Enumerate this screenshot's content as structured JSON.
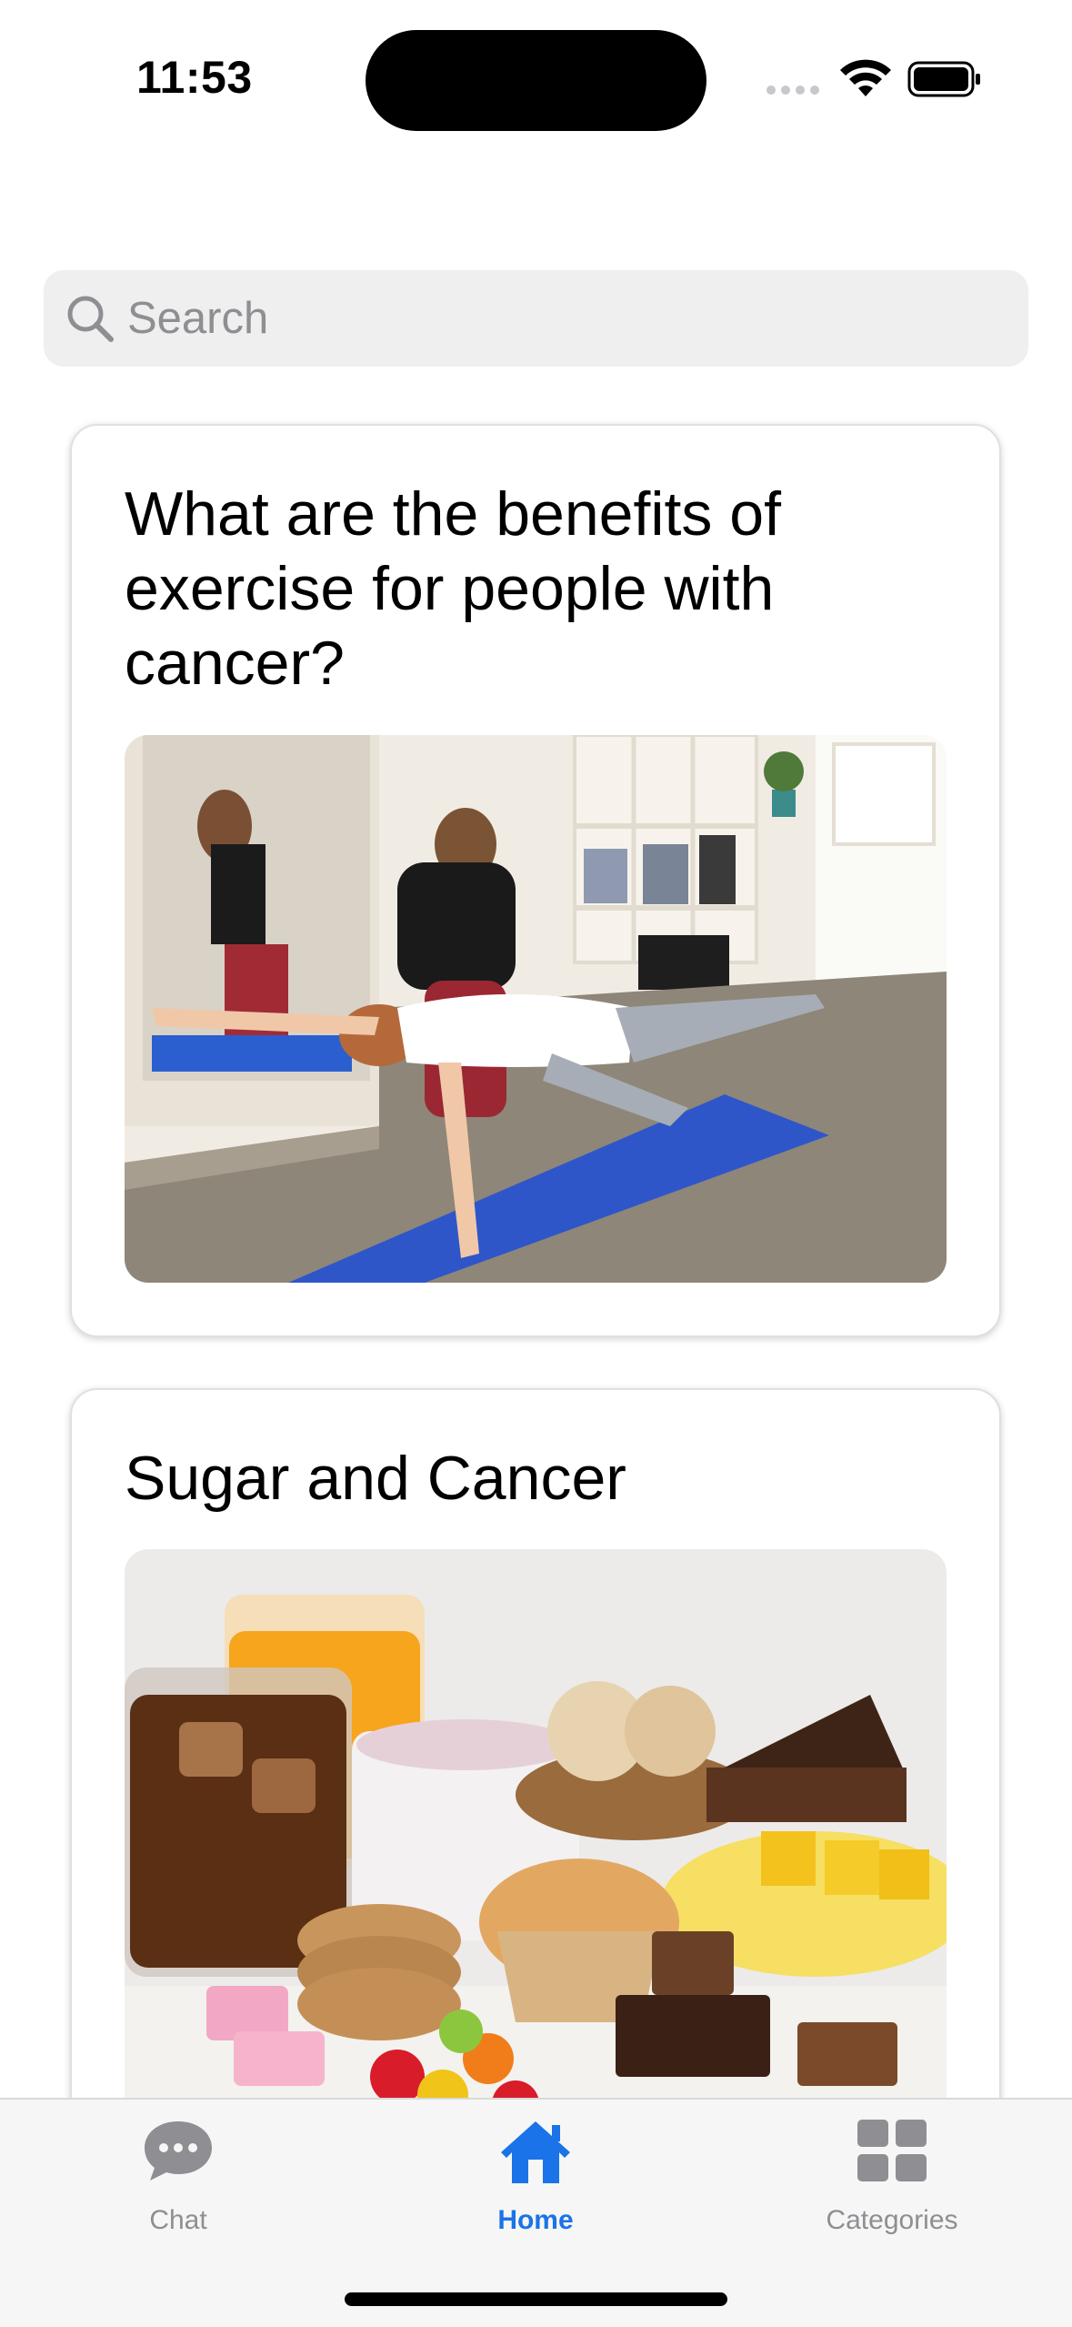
{
  "status_bar": {
    "time": "11:53"
  },
  "search": {
    "placeholder": "Search",
    "value": ""
  },
  "articles": [
    {
      "title": "What are the benefits of exercise for people with cancer?",
      "image_desc": "exercise-photo"
    },
    {
      "title": "Sugar and Cancer",
      "image_desc": "sugary-foods-photo"
    }
  ],
  "tab_bar": {
    "tabs": [
      {
        "label": "Chat",
        "icon": "chat-bubble-icon",
        "active": false
      },
      {
        "label": "Home",
        "icon": "home-icon",
        "active": true
      },
      {
        "label": "Categories",
        "icon": "grid-icon",
        "active": false
      }
    ]
  },
  "colors": {
    "accent": "#1a73e8",
    "inactive": "#8e8e93",
    "search_bg": "#efefef"
  }
}
